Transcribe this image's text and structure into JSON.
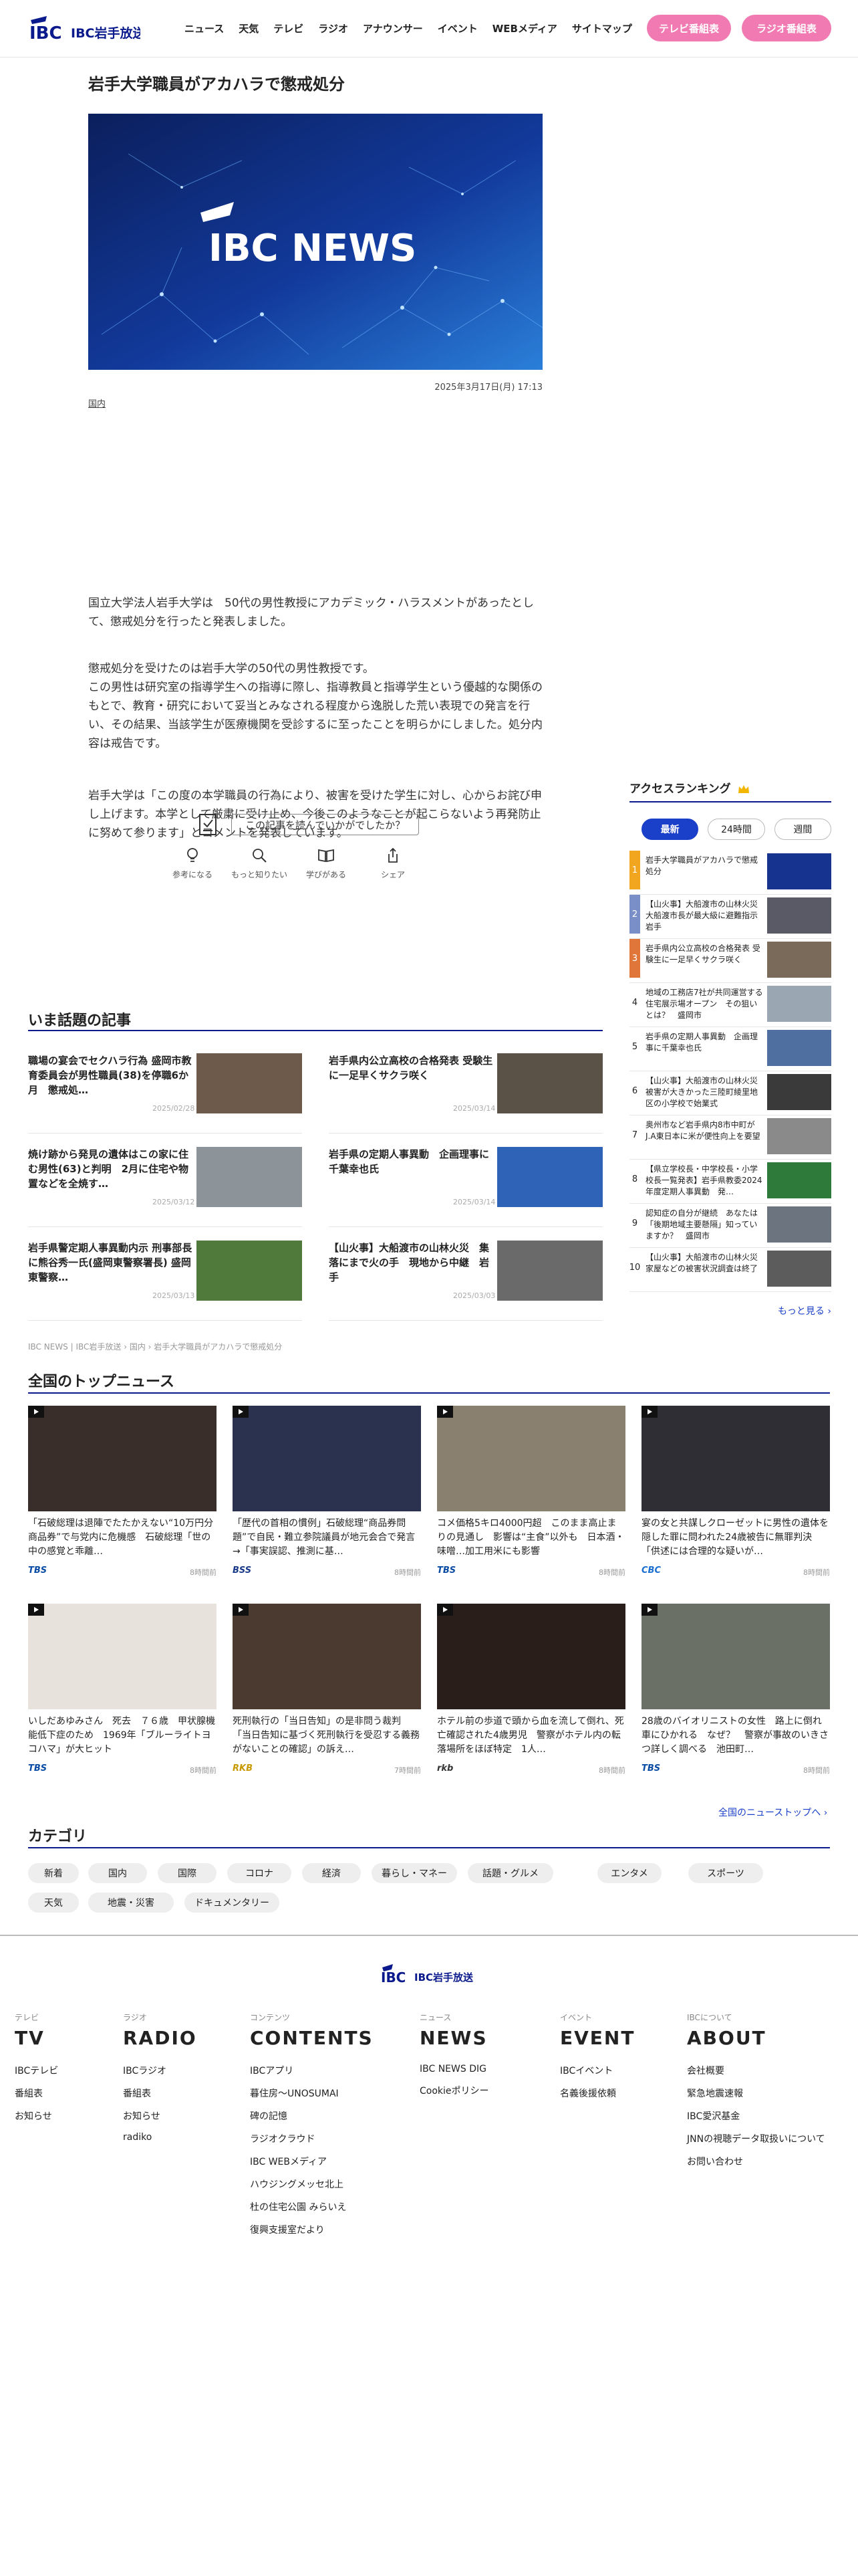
{
  "header": {
    "logo_text": "IBC岩手放送",
    "nav": [
      "ニュース",
      "天気",
      "テレビ",
      "ラジオ",
      "アナウンサー",
      "イベント",
      "WEBメディア",
      "サイトマップ"
    ],
    "tv_schedule": "テレビ番組表",
    "radio_schedule": "ラジオ番組表"
  },
  "article": {
    "title": "岩手大学職員がアカハラで懲戒処分",
    "hero_text": "IBC NEWS",
    "date": "2025年3月17日(月) 17:13",
    "category": "国内",
    "paragraphs": [
      "国立大学法人岩手大学は　50代の男性教授にアカデミック・ハラスメントがあったとして、懲戒処分を行ったと発表しました。",
      "懲戒処分を受けたのは岩手大学の50代の男性教授です。\nこの男性は研究室の指導学生への指導に際し、指導教員と指導学生という優越的な関係のもとで、教育・研究において妥当とみなされる程度から逸脱した荒い表現での発言を行い、その結果、当該学生が医療機関を受診するに至ったことを明らかにしました。処分内容は戒告です。",
      "岩手大学は「この度の本学職員の行為により、被害を受けた学生に対し、心からお詫び申し上げます。本学として厳粛に受け止め、今後このようなことが起こらないよう再発防止に努めて参ります」とコメントを発表しています。"
    ],
    "question": "この記事を読んでいかがでしたか？",
    "reactions": [
      "参考になる",
      "もっと知りたい",
      "学びがある",
      "シェア"
    ]
  },
  "ranking": {
    "title": "アクセスランキング",
    "tabs": [
      "最新",
      "24時間",
      "週間"
    ],
    "items": [
      {
        "rank": "1",
        "text": "岩手大学職員がアカハラで懲戒処分",
        "color": "#f2a51f"
      },
      {
        "rank": "2",
        "text": "【山火事】大船渡市の山林火災 大船渡市長が最大級に避難指示 岩手",
        "color": "#7a8fc7"
      },
      {
        "rank": "3",
        "text": "岩手県内公立高校の合格発表 受験生に一足早くサクラ咲く",
        "color": "#e0763a"
      },
      {
        "rank": "4",
        "text": "地域の工務店7社が共同運営する住宅展示場オープン　その狙いとは？　盛岡市",
        "color": "#ffffff"
      },
      {
        "rank": "5",
        "text": "岩手県の定期人事異動　企画理事に千葉幸也氏",
        "color": "#ffffff"
      },
      {
        "rank": "6",
        "text": "【山火事】大船渡市の山林火災 被害が大きかった三陸町綾里地区の小学校で始業式",
        "color": "#ffffff"
      },
      {
        "rank": "7",
        "text": "奥州市など岩手県内8市中町がJ.A東日本に米が便性向上を要望",
        "color": "#ffffff"
      },
      {
        "rank": "8",
        "text": "【県立学校長・中学校長・小学校長一覧発表】岩手県教委2024年度定期人事異動　発…",
        "color": "#ffffff"
      },
      {
        "rank": "9",
        "text": "認知症の自分が継続　あなたは「後期地域主要懸隔」知っていますか？　盛岡市",
        "color": "#ffffff"
      },
      {
        "rank": "10",
        "text": "【山火事】大船渡市の山林火災 家屋などの被害状況調査は終了",
        "color": "#ffffff"
      }
    ],
    "more": "もっと見る ›"
  },
  "hot": {
    "title": "いま話題の記事",
    "items": [
      {
        "text": "職場の宴会でセクハラ行為 盛岡市教育委員会が男性職員(38)を停職6か月　懲戒処…",
        "date": "2025/02/28"
      },
      {
        "text": "岩手県内公立高校の合格発表 受験生に一足早くサクラ咲く",
        "date": "2025/03/14"
      },
      {
        "text": "焼け跡から発見の遺体はこの家に住む男性(63)と判明　2月に住宅や物置などを全焼す…",
        "date": "2025/03/12"
      },
      {
        "text": "岩手県の定期人事異動　企画理事に千葉幸也氏",
        "date": "2025/03/14"
      },
      {
        "text": "岩手県警定期人事異動内示 刑事部長に熊谷秀一氏(盛岡東警察署長) 盛岡東警察…",
        "date": "2025/03/13"
      },
      {
        "text": "【山火事】大船渡市の山林火災　集落にまで火の手　現地から中継　岩手",
        "date": "2025/03/03"
      }
    ],
    "breadcrumb": "IBC NEWS | IBC岩手放送 › 国内 › 岩手大学職員がアカハラで懲戒処分"
  },
  "national": {
    "title": "全国のトップニュース",
    "items": [
      {
        "text": "「石破総理は退陣でたたかえない“10万円分商品券”で与党内に危機感　石破総理「世の中の感覚と乖離…",
        "source": "TBS",
        "time": "8時間前",
        "color": "#0a4ba3"
      },
      {
        "text": "「歴代の首相の慣例」石破総理“商品券問題”で自民・難立参院議員が地元会合で発言→「事実誤認、推測に基…",
        "source": "BSS",
        "time": "8時間前",
        "color": "#1a3a8a"
      },
      {
        "text": "コメ価格5キロ4000円超　このまま高止まりの見通し　影響は“主食”以外も　日本酒・味噌…加工用米にも影響",
        "source": "TBS",
        "time": "8時間前",
        "color": "#0a4ba3"
      },
      {
        "text": "宴の女と共謀しクローゼットに男性の遺体を隠した罪に問われた24歳被告に無罪判決「供述には合理的な疑いが…",
        "source": "CBC",
        "time": "8時間前",
        "color": "#1a6fd0"
      },
      {
        "text": "いしだあゆみさん　死去　７６歳　甲状腺機能低下症のため　1969年「ブルーライトヨコハマ」が大ヒット",
        "source": "TBS",
        "time": "8時間前",
        "color": "#0a4ba3"
      },
      {
        "text": "死刑執行の「当日告知」の是非問う裁判　「当日告知に基づく死刑執行を受忍する義務がないことの確認」の訴え…",
        "source": "RKB",
        "time": "7時間前",
        "color": "#c99a00"
      },
      {
        "text": "ホテル前の歩道で頭から血を流して倒れ、死亡確認された4歳男児　警察がホテル内の転落場所をほぼ特定　1人…",
        "source": "rkb",
        "time": "8時間前",
        "color": "#333333"
      },
      {
        "text": "28歳のバイオリニストの女性　路上に倒れ車にひかれる　なぜ？　警察が事故のいきさつ詳しく調べる　池田町…",
        "source": "TBS",
        "time": "8時間前",
        "color": "#0a4ba3"
      }
    ],
    "more": "全国のニューストップへ ›"
  },
  "categories": {
    "title": "カテゴリ",
    "items": [
      "新着",
      "国内",
      "国際",
      "コロナ",
      "経済",
      "暮らし・マネー",
      "話題・グルメ",
      "エンタメ",
      "スポーツ",
      "天気",
      "地震・災害",
      "ドキュメンタリー"
    ]
  },
  "footer": {
    "logo_text": "IBC岩手放送",
    "cols": [
      {
        "sub": "テレビ",
        "head": "TV",
        "links": [
          "IBCテレビ",
          "番組表",
          "お知らせ"
        ]
      },
      {
        "sub": "ラジオ",
        "head": "RADIO",
        "links": [
          "IBCラジオ",
          "番組表",
          "お知らせ",
          "radiko"
        ]
      },
      {
        "sub": "コンテンツ",
        "head": "CONTENTS",
        "links": [
          "IBCアプリ",
          "暮住房〜UNOSUMAI",
          "碑の記憶",
          "ラジオクラウド",
          "IBC WEBメディア",
          "ハウジングメッセ北上",
          "杜の住宅公園 みらいえ",
          "復興支援室だより"
        ]
      },
      {
        "sub": "ニュース",
        "head": "NEWS",
        "links": [
          "IBC NEWS DIG",
          "Cookieポリシー"
        ]
      },
      {
        "sub": "イベント",
        "head": "EVENT",
        "links": [
          "IBCイベント",
          "名義後援依頼"
        ]
      },
      {
        "sub": "IBCについて",
        "head": "ABOUT",
        "links": [
          "会社概要",
          "緊急地震速報",
          "IBC愛沢基金",
          "JNNの視聴データ取扱いについて",
          "お問い合わせ"
        ]
      }
    ]
  },
  "colors": {
    "brand": "#0a1a8c",
    "pink": "#f07ab1",
    "accent": "#1a3fc9"
  }
}
